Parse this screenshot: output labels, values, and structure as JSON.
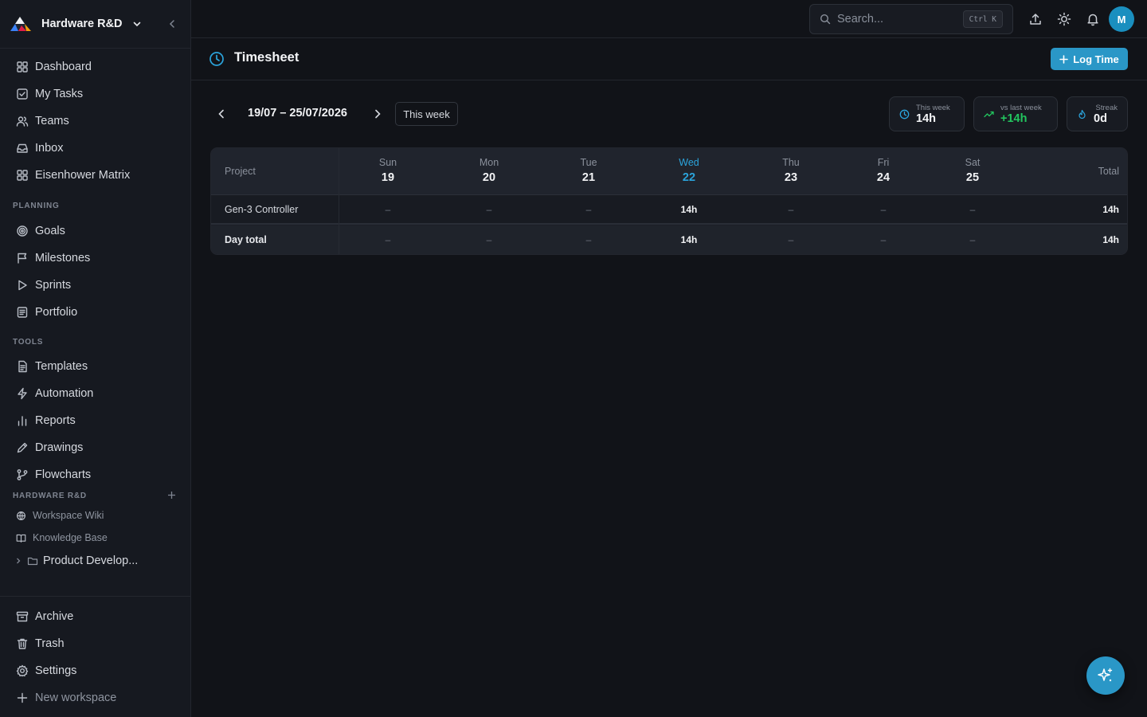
{
  "workspace": {
    "name": "Hardware R&D"
  },
  "sidebar": {
    "main": [
      {
        "label": "Dashboard",
        "icon": "dashboard-icon"
      },
      {
        "label": "My Tasks",
        "icon": "checkbox-icon"
      },
      {
        "label": "Teams",
        "icon": "users-icon"
      },
      {
        "label": "Inbox",
        "icon": "inbox-icon"
      },
      {
        "label": "Eisenhower Matrix",
        "icon": "grid-icon"
      }
    ],
    "planning_title": "PLANNING",
    "planning": [
      {
        "label": "Goals",
        "icon": "target-icon"
      },
      {
        "label": "Milestones",
        "icon": "flag-icon"
      },
      {
        "label": "Sprints",
        "icon": "play-icon"
      },
      {
        "label": "Portfolio",
        "icon": "portfolio-icon"
      }
    ],
    "tools_title": "TOOLS",
    "tools": [
      {
        "label": "Templates",
        "icon": "document-icon"
      },
      {
        "label": "Automation",
        "icon": "lightning-icon"
      },
      {
        "label": "Reports",
        "icon": "bar-chart-icon"
      },
      {
        "label": "Drawings",
        "icon": "pen-icon"
      },
      {
        "label": "Flowcharts",
        "icon": "branch-icon"
      }
    ],
    "workspace_title": "HARDWARE R&D",
    "workspace_items": [
      {
        "label": "Workspace Wiki",
        "icon": "globe-icon"
      },
      {
        "label": "Knowledge Base",
        "icon": "book-icon"
      }
    ],
    "folder": {
      "label": "Product Develop..."
    },
    "bottom": [
      {
        "label": "Archive",
        "icon": "archive-icon"
      },
      {
        "label": "Trash",
        "icon": "trash-icon"
      },
      {
        "label": "Settings",
        "icon": "gear-icon"
      },
      {
        "label": "New workspace",
        "icon": "plus-icon"
      }
    ]
  },
  "topbar": {
    "search_placeholder": "Search...",
    "search_shortcut": "Ctrl K",
    "avatar_initial": "M"
  },
  "page": {
    "title": "Timesheet",
    "log_time_label": "Log Time"
  },
  "week": {
    "range": "19/07 – 25/07/2026",
    "this_week_label": "This week"
  },
  "stats": [
    {
      "label": "This week",
      "value": "14h",
      "color": "#f4f5f7"
    },
    {
      "label": "vs last week",
      "value": "+14h",
      "color": "#22c55e"
    },
    {
      "label": "Streak",
      "value": "0d",
      "color": "#f4f5f7"
    }
  ],
  "table": {
    "project_header": "Project",
    "total_header": "Total",
    "days": [
      {
        "dow": "Sun",
        "num": "19",
        "today": false
      },
      {
        "dow": "Mon",
        "num": "20",
        "today": false
      },
      {
        "dow": "Tue",
        "num": "21",
        "today": false
      },
      {
        "dow": "Wed",
        "num": "22",
        "today": true
      },
      {
        "dow": "Thu",
        "num": "23",
        "today": false
      },
      {
        "dow": "Fri",
        "num": "24",
        "today": false
      },
      {
        "dow": "Sat",
        "num": "25",
        "today": false
      }
    ],
    "rows": [
      {
        "label": "Gen-3 Controller",
        "cells": [
          "–",
          "–",
          "–",
          "14h",
          "–",
          "–",
          "–"
        ],
        "total": "14h"
      },
      {
        "label": "Day total",
        "cells": [
          "–",
          "–",
          "–",
          "14h",
          "–",
          "–",
          "–"
        ],
        "total": "14h"
      }
    ]
  },
  "colors": {
    "accent": "#2a97c7",
    "today": "#2ba4dc",
    "positive": "#22c55e"
  }
}
